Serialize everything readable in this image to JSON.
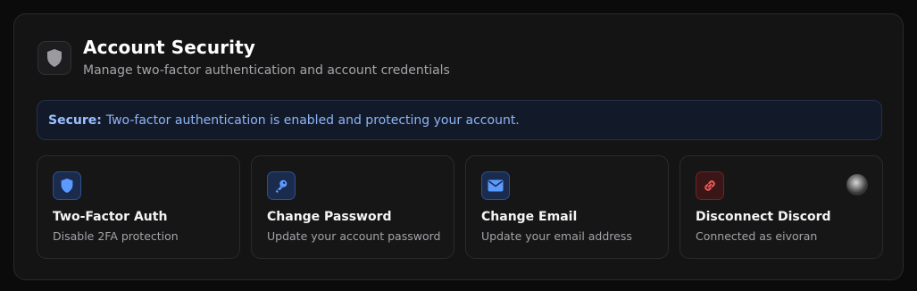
{
  "header": {
    "icon": "shield-icon",
    "title": "Account Security",
    "subtitle": "Manage two-factor authentication and account credentials"
  },
  "banner": {
    "label": "Secure:",
    "message": "Two-factor authentication is enabled and protecting your account."
  },
  "cards": [
    {
      "icon": "shield-icon",
      "title": "Two-Factor Auth",
      "description": "Disable 2FA protection"
    },
    {
      "icon": "key-icon",
      "title": "Change Password",
      "description": "Update your account password"
    },
    {
      "icon": "envelope-icon",
      "title": "Change Email",
      "description": "Update your email address"
    },
    {
      "icon": "link-icon",
      "title": "Disconnect Discord",
      "description": "Connected as eivoran"
    }
  ],
  "colors": {
    "accent_blue": "#3b82f6",
    "danger_red": "#ef4444",
    "banner_text": "#8fb5f5"
  }
}
